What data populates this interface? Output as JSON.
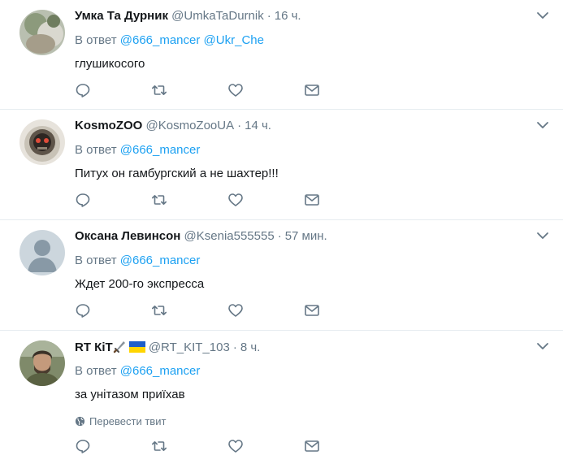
{
  "reply_prefix": "В ответ",
  "translate_label": "Перевести твит",
  "colors": {
    "link": "#1da1f2",
    "muted": "#657786",
    "text": "#14171a",
    "border": "#e6ecf0"
  },
  "tweets": [
    {
      "name": "Умка Та Дурник",
      "handle": "@UmkaTaDurnik",
      "time": "16 ч.",
      "mentions": [
        "@666_mancer",
        "@Ukr_Che"
      ],
      "text": "глушикосого"
    },
    {
      "name": "KosmoZOO",
      "handle": "@KosmoZooUA",
      "time": "14 ч.",
      "mentions": [
        "@666_mancer"
      ],
      "text": "Питух он гамбургский а не шахтер!!!"
    },
    {
      "name": "Оксана Левинсон",
      "handle": "@Ksenia555555",
      "time": "57 мин.",
      "mentions": [
        "@666_mancer"
      ],
      "text": "Ждет 200-го экспресса"
    },
    {
      "name": "RT КiТ",
      "handle": "@RT_KIT_103",
      "time": "8 ч.",
      "mentions": [
        "@666_mancer"
      ],
      "text": "за унітазом приїхав"
    }
  ]
}
